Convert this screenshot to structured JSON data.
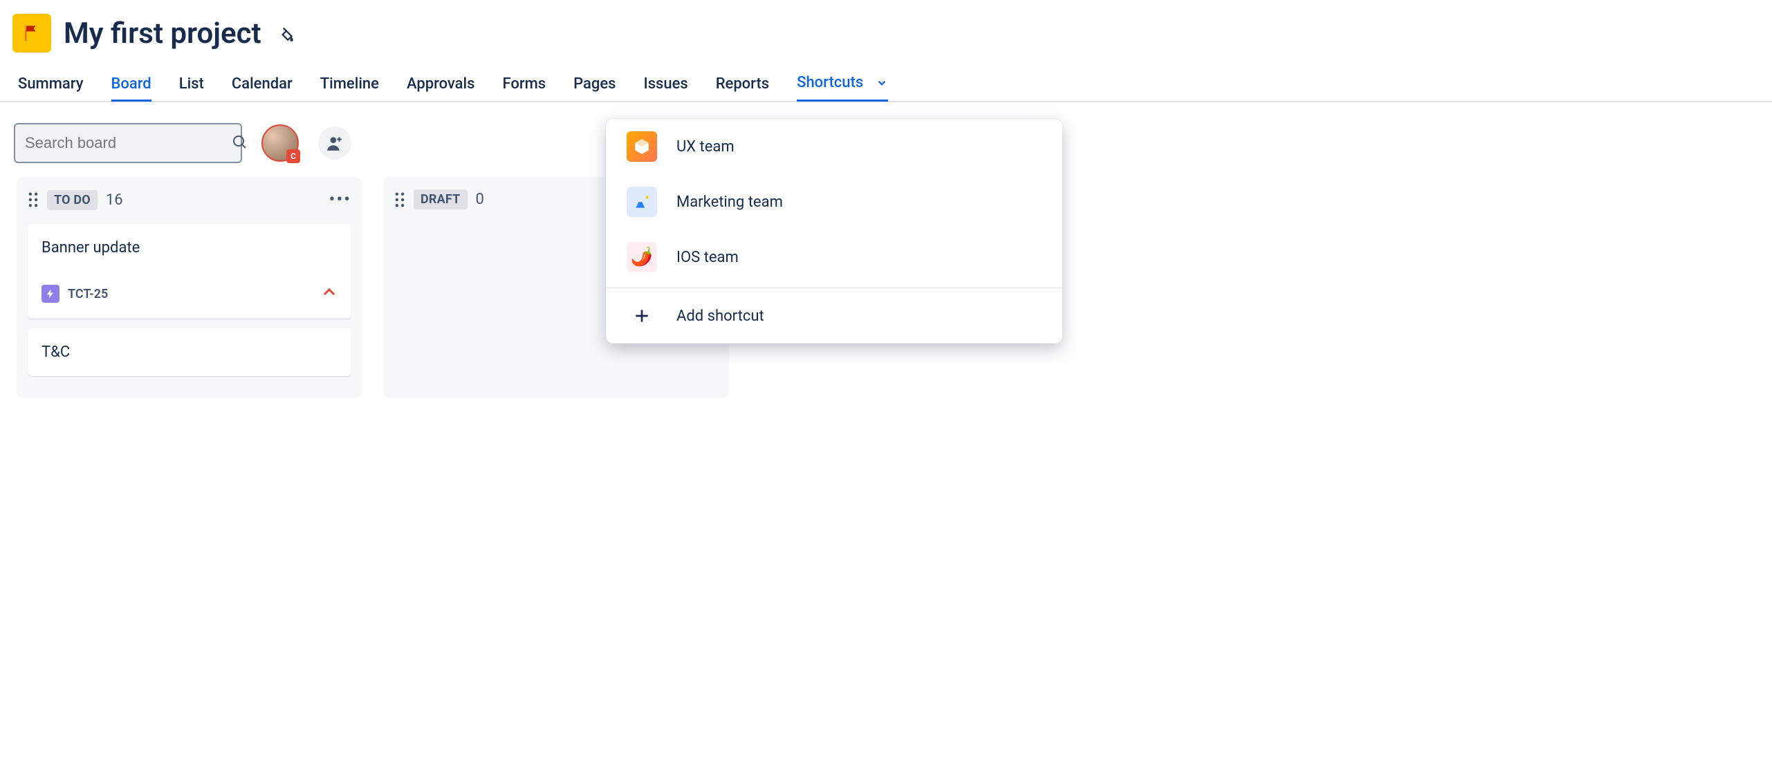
{
  "project": {
    "title": "My first project",
    "icon_color": "#FFC400"
  },
  "tabs": [
    {
      "label": "Summary",
      "state": "normal"
    },
    {
      "label": "Board",
      "state": "active"
    },
    {
      "label": "List",
      "state": "normal"
    },
    {
      "label": "Calendar",
      "state": "normal"
    },
    {
      "label": "Timeline",
      "state": "normal"
    },
    {
      "label": "Approvals",
      "state": "normal"
    },
    {
      "label": "Forms",
      "state": "normal"
    },
    {
      "label": "Pages",
      "state": "normal"
    },
    {
      "label": "Issues",
      "state": "normal"
    },
    {
      "label": "Reports",
      "state": "normal"
    },
    {
      "label": "Shortcuts",
      "state": "open"
    }
  ],
  "search": {
    "placeholder": "Search board"
  },
  "avatar_badge": "C",
  "columns": [
    {
      "status": "TO DO",
      "count": "16",
      "show_more": true,
      "cards": [
        {
          "title": "Banner update",
          "key": "TCT-25",
          "priority": "high"
        },
        {
          "title": "T&C"
        }
      ]
    },
    {
      "status": "DRAFT",
      "count": "0",
      "show_more": false,
      "cards": []
    }
  ],
  "shortcuts_menu": {
    "items": [
      {
        "label": "UX team",
        "icon": "cube",
        "bg": "#FF991F"
      },
      {
        "label": "Marketing team",
        "icon": "mountain",
        "bg": "#DEEBFF"
      },
      {
        "label": "IOS team",
        "icon": "chili",
        "bg": "#FFD5D2"
      }
    ],
    "add_label": "Add shortcut"
  }
}
